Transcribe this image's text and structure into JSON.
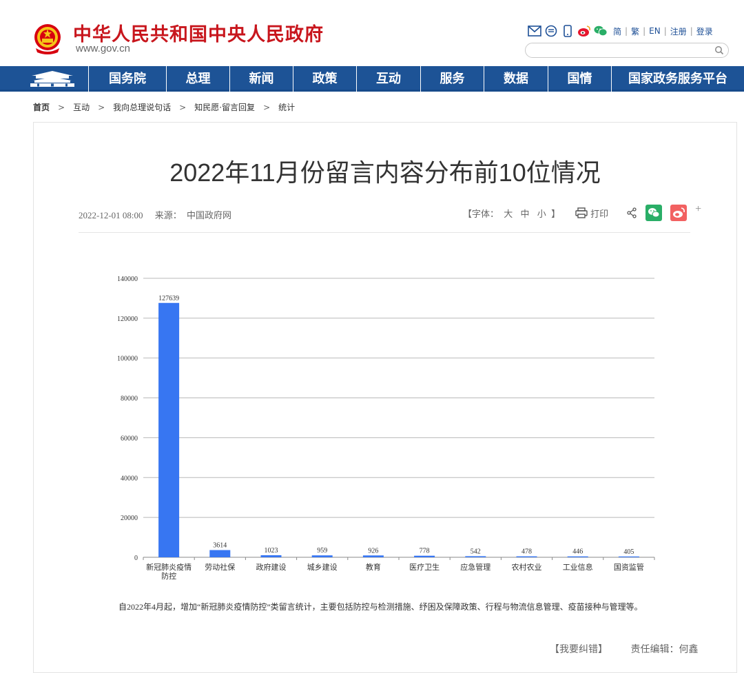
{
  "header": {
    "site_title": "中华人民共和国中央人民政府",
    "site_domain": "www.gov.cn",
    "lang_links": [
      "简",
      "繁",
      "EN",
      "注册",
      "登录"
    ],
    "search_placeholder": ""
  },
  "nav": {
    "items": [
      "国务院",
      "总理",
      "新闻",
      "政策",
      "互动",
      "服务",
      "数据",
      "国情",
      "国家政务服务平台"
    ]
  },
  "breadcrumb": [
    "首页",
    "互动",
    "我向总理说句话",
    "知民愿·留言回复",
    "统计"
  ],
  "article": {
    "title": "2022年11月份留言内容分布前10位情况",
    "date": "2022-12-01 08:00",
    "source_label": "来源：",
    "source": "中国政府网",
    "font_label": "【字体：",
    "font_sizes": [
      "大",
      "中",
      "小"
    ],
    "font_end": "】",
    "print_label": "打印",
    "footnote": "自2022年4月起，增加“新冠肺炎疫情防控”类留言统计，主要包括防控与检测措施、纾困及保障政策、行程与物流信息管理、疫苗接种与管理等。",
    "report_error": "【我要纠错】",
    "editor": "责任编辑：何鑫"
  },
  "chart_data": {
    "type": "bar",
    "categories": [
      "新冠肺炎疫情防控",
      "劳动社保",
      "政府建设",
      "城乡建设",
      "教育",
      "医疗卫生",
      "应急管理",
      "农村农业",
      "工业信息",
      "国资监管"
    ],
    "category_lines": [
      [
        "新冠肺炎疫情",
        "防控"
      ],
      [
        "劳动社保"
      ],
      [
        "政府建设"
      ],
      [
        "城乡建设"
      ],
      [
        "教育"
      ],
      [
        "医疗卫生"
      ],
      [
        "应急管理"
      ],
      [
        "农村农业"
      ],
      [
        "工业信息"
      ],
      [
        "国资监管"
      ]
    ],
    "values": [
      127639,
      3614,
      1023,
      959,
      926,
      778,
      542,
      478,
      446,
      405
    ],
    "ylim": [
      0,
      140000
    ],
    "yticks": [
      0,
      20000,
      40000,
      60000,
      80000,
      100000,
      120000,
      140000
    ],
    "grid": true,
    "bar_color": "#3776f2",
    "title": "",
    "xlabel": "",
    "ylabel": ""
  },
  "colors": {
    "brand_red": "#c8161d",
    "nav_blue": "#1d5396",
    "wechat_green": "#2aae67",
    "weibo_red": "#e6162d"
  },
  "icons": [
    "national-emblem-icon",
    "mail-icon",
    "message-icon",
    "mobile-icon",
    "weibo-icon",
    "wechat-icon",
    "search-icon",
    "tiananmen-icon",
    "print-icon",
    "share-icon"
  ]
}
